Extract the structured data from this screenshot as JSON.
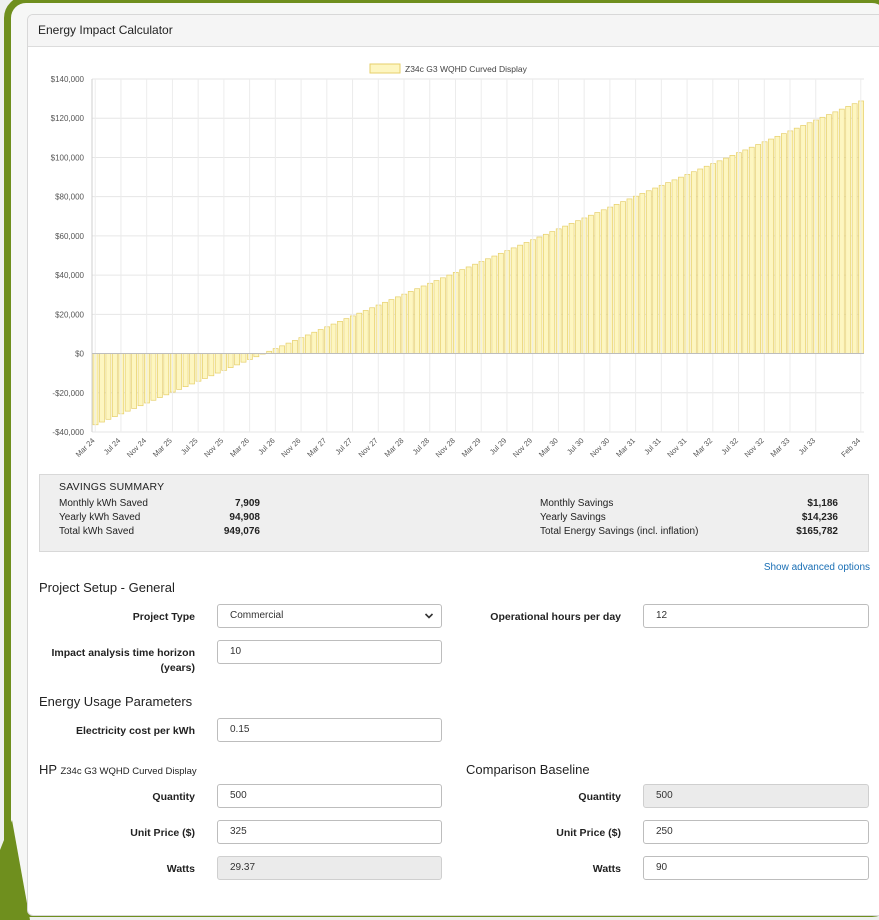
{
  "panel": {
    "title": "Energy Impact Calculator"
  },
  "chart_data": {
    "type": "bar",
    "legend_label": "Z34c G3 WQHD Curved Display",
    "legend_position": "top",
    "bar_color": "#fdf6c1",
    "bar_border_color": "#e6cf6a",
    "ylim": [
      -40000,
      140000
    ],
    "yticks": [
      "$140,000",
      "$120,000",
      "$100,000",
      "$80,000",
      "$60,000",
      "$40,000",
      "$20,000",
      "$0",
      "-$20,000",
      "-$40,000"
    ],
    "ytick_values": [
      140000,
      120000,
      100000,
      80000,
      60000,
      40000,
      20000,
      0,
      -20000,
      -40000
    ],
    "xtick_labels": [
      "Mar 24",
      "Jul 24",
      "Nov 24",
      "Mar 25",
      "Jul 25",
      "Nov 25",
      "Mar 26",
      "Jul 26",
      "Nov 26",
      "Mar 27",
      "Jul 27",
      "Nov 27",
      "Mar 28",
      "Jul 28",
      "Nov 28",
      "Mar 29",
      "Jul 29",
      "Nov 29",
      "Mar 30",
      "Jul 30",
      "Nov 30",
      "Mar 31",
      "Jul 31",
      "Nov 31",
      "Mar 32",
      "Jul 32",
      "Nov 32",
      "Mar 33",
      "Jul 33",
      "Feb 34"
    ],
    "series_start": {
      "month": "Mar 24",
      "value": -36300
    },
    "series_end": {
      "month": "Feb 34",
      "value": 128800
    },
    "num_points": 120,
    "grid": true
  },
  "summary": {
    "title": "SAVINGS SUMMARY",
    "left": [
      {
        "label": "Monthly kWh Saved",
        "value": "7,909"
      },
      {
        "label": "Yearly kWh Saved",
        "value": "94,908"
      },
      {
        "label": "Total kWh Saved",
        "value": "949,076"
      }
    ],
    "right": [
      {
        "label": "Monthly Savings",
        "value": "$1,186"
      },
      {
        "label": "Yearly Savings",
        "value": "$14,236"
      },
      {
        "label": "Total Energy Savings (incl. inflation)",
        "value": "$165,782"
      }
    ]
  },
  "advanced_link": "Show advanced options",
  "general": {
    "title": "Project Setup - General",
    "project_type_label": "Project Type",
    "project_type_value": "Commercial",
    "hours_label": "Operational hours per day",
    "hours_value": "12",
    "horizon_label_1": "Impact analysis time horizon",
    "horizon_label_2": "(years)",
    "horizon_value": "10"
  },
  "energy": {
    "title": "Energy Usage Parameters",
    "cost_label": "Electricity cost per kWh",
    "cost_value": "0.15"
  },
  "product": {
    "brand": "HP",
    "model": "Z34c G3 WQHD Curved Display",
    "quantity_label": "Quantity",
    "quantity_value": "500",
    "price_label": "Unit Price ($)",
    "price_value": "325",
    "watts_label": "Watts",
    "watts_value": "29.37"
  },
  "baseline": {
    "title": "Comparison Baseline",
    "quantity_label": "Quantity",
    "quantity_value": "500",
    "price_label": "Unit Price ($)",
    "price_value": "250",
    "watts_label": "Watts",
    "watts_value": "90"
  }
}
